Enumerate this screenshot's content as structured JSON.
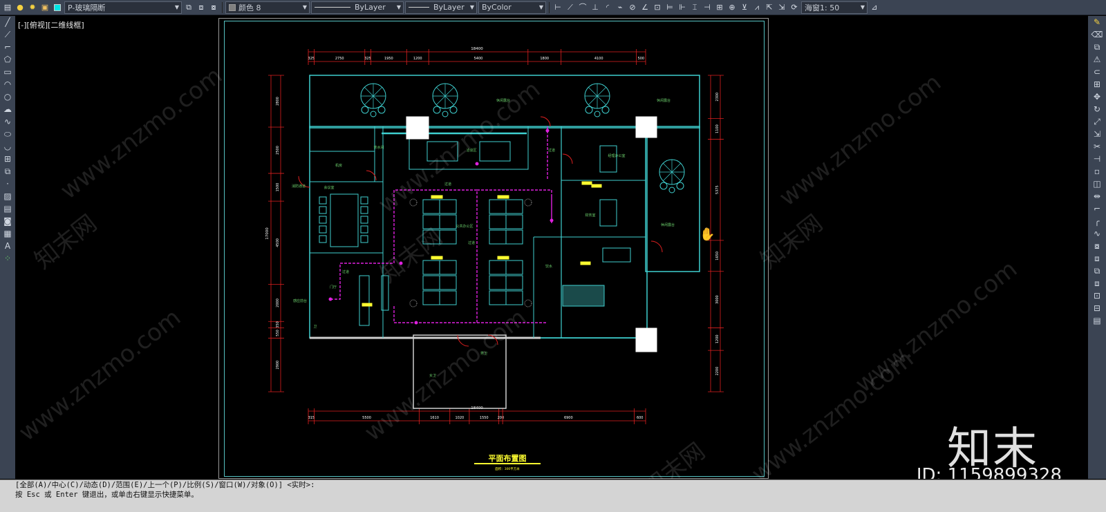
{
  "toolbar": {
    "layer_name": "P-玻璃隔断",
    "color_label": "颜色 8",
    "linetype_label": "ByLayer",
    "lineweight_label": "ByLayer",
    "plotstyle_label": "ByColor",
    "annotation_scale": "海窗1: 50",
    "layer_color": "#00e5e5"
  },
  "viewport": {
    "view_label": "[-][俯视][二维线框]"
  },
  "drawing": {
    "title": "平面布置图",
    "subtitle": "面积：300平方米",
    "dims_top": {
      "total": "18400",
      "segments": [
        "325",
        "2750",
        "325",
        "1950",
        "1200",
        "5400",
        "1800",
        "4100",
        "500"
      ]
    },
    "dims_bottom": {
      "total": "18400",
      "segments": [
        "315",
        "5500",
        "1610",
        "1020",
        "1550",
        "200",
        "6900",
        "600"
      ]
    },
    "dims_left": {
      "total": "17000",
      "segments": [
        "2800",
        "2500",
        "1500",
        "4500",
        "2000",
        "350",
        "550",
        "2900"
      ]
    },
    "dims_right": {
      "total": "17300",
      "segments": [
        "2300",
        "1100",
        "5375",
        "1650",
        "3000",
        "1200",
        "2200"
      ]
    },
    "rooms": {
      "leisure_1": "休闲露台",
      "leisure_2": "休闲露台",
      "leisure_3": "休闲露台",
      "machine_room": "机房",
      "negotiation": "洽谈区",
      "manager": "经理办公室",
      "corridor_1": "过道",
      "corridor_2": "过道",
      "corridor_3": "过道",
      "corridor_4": "过道",
      "meeting": "会议室",
      "fire_exit": "消防通道",
      "public_office": "公共办公区",
      "finance": "财务室",
      "hall": "门厅",
      "reception": "感应前台",
      "female_wc": "女卫",
      "male_wc": "男卫",
      "pantry": "茶水间",
      "water": "饮水",
      "label_z": "卫"
    }
  },
  "watermark": {
    "text": "www.znzmo.com",
    "brand_cn": "知末网",
    "logo_text": "知末",
    "id_text": "ID: 1159899328"
  },
  "command": {
    "line1": "[全部(A)/中心(C)/动态(D)/范围(E)/上一个(P)/比例(S)/窗口(W)/对象(O)] <实时>:",
    "line2": "按 Esc 或 Enter 键退出，或单击右键显示快捷菜单。"
  }
}
